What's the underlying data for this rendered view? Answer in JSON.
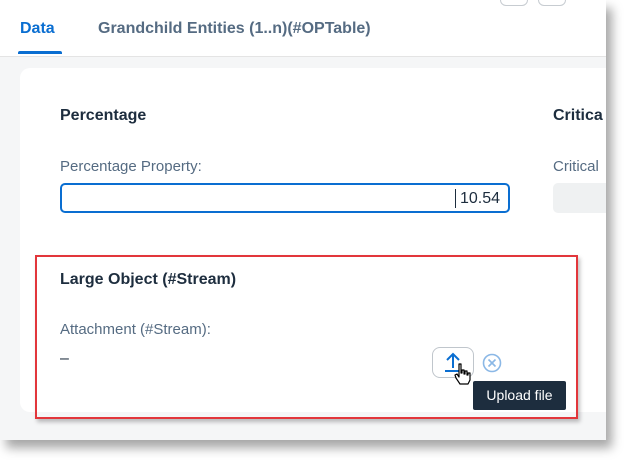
{
  "tabs": [
    {
      "label": "Data",
      "active": true
    },
    {
      "label": "Grandchild Entities (1..n)(#OPTable)",
      "active": false
    }
  ],
  "sections": {
    "percentage": {
      "title": "Percentage",
      "field_label": "Percentage Property:",
      "field_value": "10.54"
    },
    "critical": {
      "title": "Critica",
      "field_label": "Critical"
    },
    "large_object": {
      "title": "Large Object (#Stream)",
      "field_label": "Attachment (#Stream):",
      "field_value": "–"
    }
  },
  "upload": {
    "tooltip": "Upload file",
    "icon": "upload-icon",
    "remove_icon": "remove-circle-icon"
  },
  "colors": {
    "accent": "#0a6ed1",
    "highlight": "#e2363b",
    "tooltip_bg": "#1d2d3e",
    "label": "#556b82"
  }
}
